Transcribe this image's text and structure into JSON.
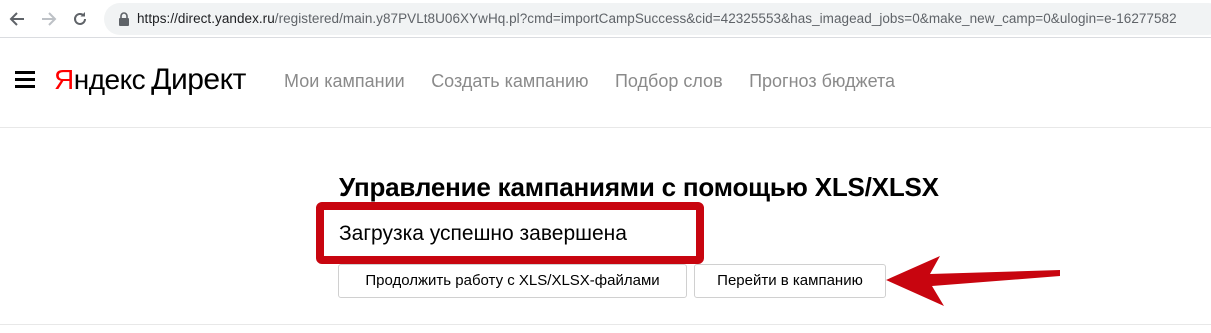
{
  "browser": {
    "url_host": "https://direct.yandex.ru",
    "url_path": "/registered/main.y87PVLt8U06XYwHq.pl?cmd=importCampSuccess&cid=42325553&has_imagead_jobs=0&make_new_camp=0&ulogin=e-16277582"
  },
  "header": {
    "logo_first_letter": "Я",
    "logo_rest": "ндекс",
    "logo_product": "Директ",
    "nav": [
      {
        "label": "Мои кампании"
      },
      {
        "label": "Создать кампанию"
      },
      {
        "label": "Подбор слов"
      },
      {
        "label": "Прогноз бюджета"
      }
    ]
  },
  "main": {
    "title": "Управление кампаниями с помощью XLS/XLSX",
    "status": "Загрузка успешно завершена",
    "continue_button": "Продолжить работу с XLS/XLSX-файлами",
    "goto_button": "Перейти в кампанию"
  },
  "colors": {
    "annotation_red": "#c8050f",
    "logo_red": "#ff0000",
    "nav_gray": "#8a8a8a"
  }
}
